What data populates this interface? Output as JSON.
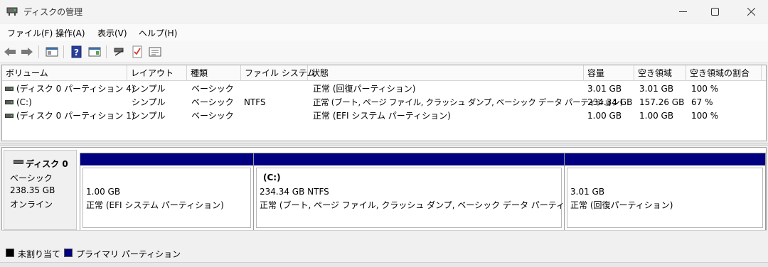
{
  "window": {
    "title": "ディスクの管理"
  },
  "menu": {
    "items": [
      "ファイル(F)",
      "操作(A)",
      "表示(V)",
      "ヘルプ(H)"
    ]
  },
  "toolbar": {
    "buttons": [
      "back-icon",
      "forward-icon",
      "console-tree-icon",
      "help-icon",
      "properties-icon",
      "connect-icon",
      "check-icon",
      "settings-icon"
    ]
  },
  "volume_list": {
    "columns": [
      "ボリューム",
      "レイアウト",
      "種類",
      "ファイル システム",
      "状態",
      "容量",
      "空き領域",
      "空き領域の割合"
    ],
    "rows": [
      {
        "volume": "(ディスク 0 パーティション 4)",
        "layout": "シンプル",
        "type": "ベーシック",
        "fs": "",
        "status": "正常 (回復パーティション)",
        "capacity": "3.01 GB",
        "free": "3.01 GB",
        "percent": "100 %"
      },
      {
        "volume": "(C:)",
        "layout": "シンプル",
        "type": "ベーシック",
        "fs": "NTFS",
        "status": "正常 (ブート, ページ ファイル, クラッシュ ダンプ, ベーシック データ パーティション)",
        "capacity": "234.34 GB",
        "free": "157.26 GB",
        "percent": "67 %"
      },
      {
        "volume": "(ディスク 0 パーティション 1)",
        "layout": "シンプル",
        "type": "ベーシック",
        "fs": "",
        "status": "正常 (EFI システム パーティション)",
        "capacity": "1.00 GB",
        "free": "1.00 GB",
        "percent": "100 %"
      }
    ]
  },
  "disk": {
    "name": "ディスク 0",
    "type": "ベーシック",
    "size": "238.35 GB",
    "state": "オンライン",
    "partitions": [
      {
        "name": "",
        "size": "1.00 GB",
        "status": "正常 (EFI システム パーティション)"
      },
      {
        "name": "(C:)",
        "size": "234.34 GB NTFS",
        "status": "正常 (ブート, ページ ファイル, クラッシュ ダンプ, ベーシック データ パーティション)"
      },
      {
        "name": "",
        "size": "3.01 GB",
        "status": "正常 (回復パーティション)"
      }
    ]
  },
  "legend": {
    "unallocated": {
      "label": "未割り当て",
      "color": "#000000"
    },
    "primary": {
      "label": "プライマリ パーティション",
      "color": "#000080"
    }
  }
}
